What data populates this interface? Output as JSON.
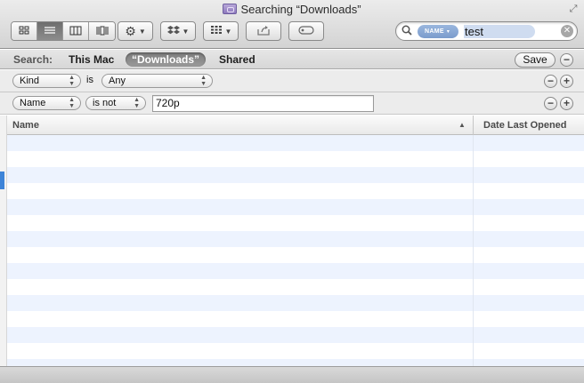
{
  "window": {
    "title": "Searching “Downloads”"
  },
  "toolbar": {
    "view_icons": [
      "icon-view-icon",
      "list-view-icon",
      "column-view-icon",
      "coverflow-view-icon"
    ],
    "action_icon": "gear-icon",
    "dropbox_icon": "dropbox-icon",
    "arrange_icon": "arrange-grid-icon",
    "share_icon": "share-icon",
    "tag_icon": "tag-icon",
    "active_view_index": 1
  },
  "search": {
    "token": "NAME",
    "query": "test"
  },
  "scope": {
    "label": "Search:",
    "items": [
      "This Mac",
      "“Downloads”",
      "Shared"
    ],
    "selected_index": 1,
    "save_label": "Save"
  },
  "criteria": [
    {
      "attribute": "Kind",
      "operator": "is",
      "value": "Any"
    },
    {
      "attribute": "Name",
      "operator": "is not",
      "value": "720p"
    }
  ],
  "list": {
    "columns": [
      "Name",
      "Date Last Opened"
    ]
  },
  "colors": {
    "selection_stripe": "#edf3fe",
    "token_blue": "#8aa9d6",
    "scope_selected": "#8a8a8a"
  }
}
